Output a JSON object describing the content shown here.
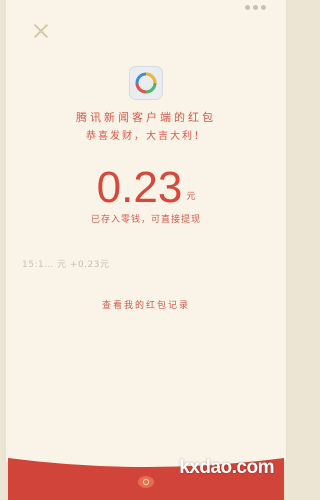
{
  "header": {
    "more_icon": "more-dots-icon",
    "close_icon": "close-icon"
  },
  "envelope": {
    "logo_icon": "tencent-news-logo-icon",
    "sender": "腾讯新闻客户端的红包",
    "greeting": "恭喜发财，大吉大利！",
    "amount": "0.23",
    "unit": "元",
    "deposit_note": "已存入零钱，可直接提现",
    "record": "15:1… 元 +0.23元",
    "history_link": "查看我的红包记录"
  },
  "footer": {
    "icon": "red-packet-icon",
    "watermark": "kxdao.com"
  },
  "colors": {
    "accent_red": "#d9473a",
    "paper": "#faf4e8",
    "background": "#ede5d3",
    "band": "#d14439"
  }
}
